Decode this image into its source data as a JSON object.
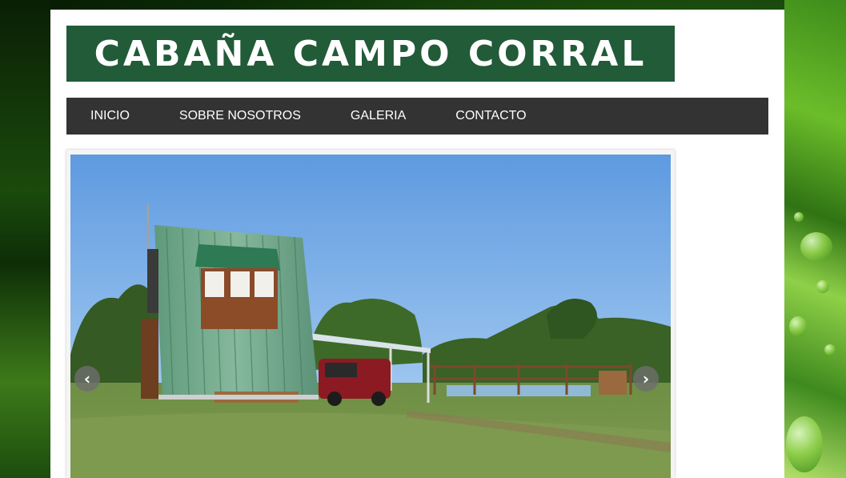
{
  "header": {
    "site_title": "CABAÑA CAMPO CORRAL"
  },
  "nav": {
    "items": [
      {
        "label": "INICIO"
      },
      {
        "label": "SOBRE NOSOTROS"
      },
      {
        "label": "GALERIA"
      },
      {
        "label": "CONTACTO"
      }
    ]
  },
  "slider": {
    "prev_icon": "chevron-left-icon",
    "next_icon": "chevron-right-icon",
    "prev_glyph": "‹",
    "next_glyph": "›",
    "image_subject": "green cabin in countryside"
  },
  "colors": {
    "logo_bg": "#215b38",
    "nav_bg": "#333333",
    "nav_text": "#ffffff"
  }
}
